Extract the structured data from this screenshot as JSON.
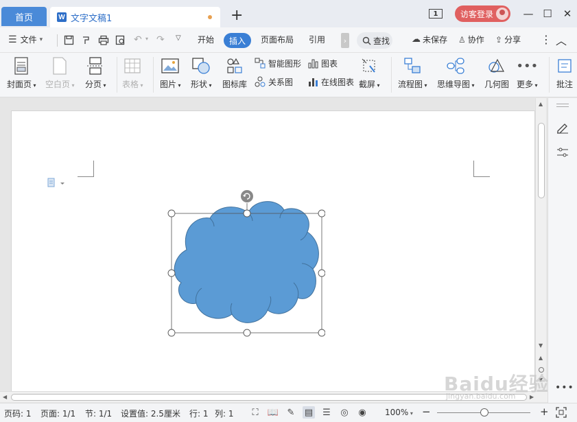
{
  "titlebar": {
    "home_tab": "首页",
    "doc_tab": "文字文稿1",
    "doc_icon_letter": "W",
    "add_tab": "+",
    "window_count": "1",
    "login_label": "访客登录",
    "minimize": "—",
    "maximize": "☐",
    "close": "✕"
  },
  "menu": {
    "file": "文件",
    "start": "开始",
    "insert": "插入",
    "layout": "页面布局",
    "reference": "引用",
    "search": "查找",
    "unsaved": "未保存",
    "collab": "协作",
    "share": "分享"
  },
  "ribbon": {
    "cover": "封面页",
    "blank_page": "空白页",
    "page_break": "分页",
    "table": "表格",
    "picture": "图片",
    "shape": "形状",
    "icon_lib": "图标库",
    "smart_shape": "智能图形",
    "chart": "图表",
    "relation": "关系图",
    "online_chart": "在线图表",
    "screenshot": "截屏",
    "flowchart": "流程图",
    "mindmap": "思维导图",
    "geometry": "几何图",
    "more": "更多",
    "annotate": "批注"
  },
  "status": {
    "page_num": "页码: 1",
    "pages": "页面: 1/1",
    "section": "节: 1/1",
    "setting": "设置值: 2.5厘米",
    "row": "行: 1",
    "col": "列: 1",
    "zoom": "100%",
    "zoom_minus": "−",
    "zoom_plus": "+"
  },
  "shape": {
    "fill": "#5b9bd5",
    "stroke": "#41719c"
  },
  "watermark": {
    "main": "Baidu经验",
    "sub": "jingyan.baidu.com"
  }
}
